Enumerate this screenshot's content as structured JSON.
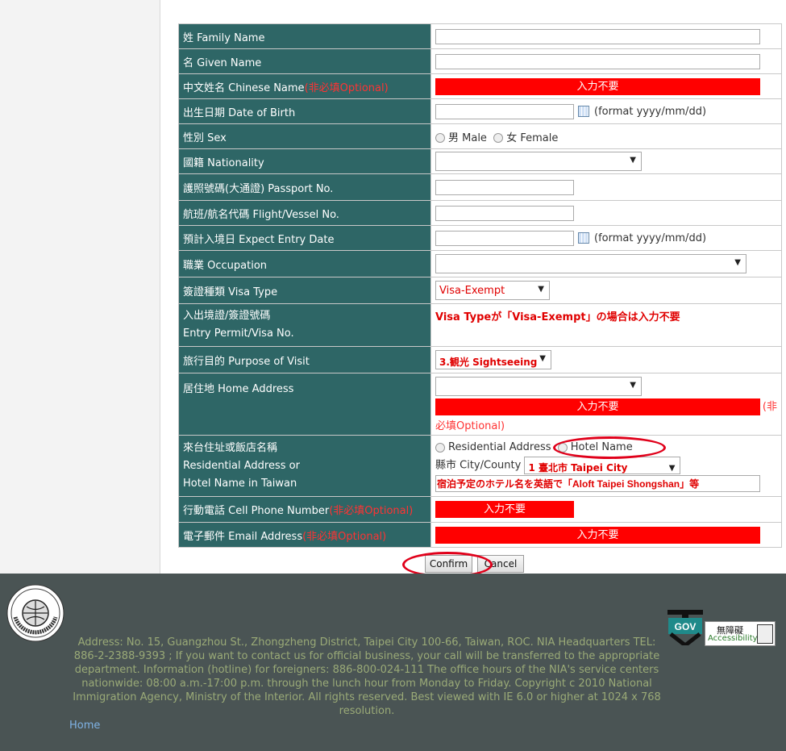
{
  "form": {
    "family_name": {
      "label": "姓 Family Name",
      "value": ""
    },
    "given_name": {
      "label": "名 Given Name",
      "value": ""
    },
    "chinese_name": {
      "label": "中文姓名 Chinese Name",
      "optional": "(非必填Optional)",
      "overlay": "入力不要"
    },
    "dob": {
      "label": "出生日期 Date of Birth",
      "value": "",
      "format": "(format yyyy/mm/dd)"
    },
    "sex": {
      "label": "性別 Sex",
      "male": "男 Male",
      "female": "女 Female"
    },
    "nationality": {
      "label": "國籍 Nationality",
      "value": ""
    },
    "passport": {
      "label": "護照號碼(大通證) Passport No.",
      "value": ""
    },
    "flight": {
      "label": "航班/航名代碼 Flight/Vessel No.",
      "value": ""
    },
    "entry_date": {
      "label": "預計入境日 Expect Entry Date",
      "value": "",
      "format": "(format yyyy/mm/dd)"
    },
    "occupation": {
      "label": "職業 Occupation",
      "value": ""
    },
    "visa_type": {
      "label": "簽證種類 Visa Type",
      "value": "Visa-Exempt"
    },
    "entry_permit": {
      "label_1": "入出境證/簽證號碼",
      "label_2": "Entry Permit/Visa No.",
      "note": "Visa Typeが「Visa-Exempt」の場合は入力不要"
    },
    "purpose": {
      "label": "旅行目的 Purpose of Visit",
      "value": "3.観光 Sightseeing"
    },
    "home_address": {
      "label": "居住地 Home Address",
      "value": "",
      "overlay": "入力不要",
      "optional_1": "(非",
      "optional_2": "必填Optional)"
    },
    "taiwan_address": {
      "label_1": "來台住址或飯店名稱",
      "label_2": "Residential Address or",
      "label_3": "Hotel Name in Taiwan",
      "residential": "Residential Address",
      "hotel": "Hotel Name",
      "city_label": "縣市 City/County",
      "city_value": "1 臺北市 Taipei City",
      "hotel_note": "宿泊予定のホテル名を英語で「Aloft Taipei Shongshan」等"
    },
    "cell_phone": {
      "label": "行動電話 Cell Phone Number",
      "optional": "(非必填Optional)",
      "overlay": "入力不要"
    },
    "email": {
      "label": "電子郵件 Email Address",
      "optional": "(非必填Optional)",
      "overlay": "入力不要"
    }
  },
  "buttons": {
    "confirm": "Confirm",
    "cancel": "Cancel"
  },
  "footer": {
    "address": "Address: No. 15, Guangzhou St., Zhongzheng District, Taipei City 100-66, Taiwan, ROC. NIA Headquarters TEL: 886-2-2388-9393 ; If you want to contact us for official business, your call will be transferred to the appropriate department. Information (hotline) for foreigners: 886-800-024-111 The office hours of the NIA's service centers nationwide: 08:00 a.m.-17:00 p.m. through the lunch hour from Monday to Friday. Copyright c 2010 National Immigration Agency, Ministry of the Interior. All rights reserved. Best viewed with IE 6.0 or higher at 1024 x 768 resolution.",
    "home": "Home",
    "logo_text": "National Immigration Agency",
    "gov": "GOV",
    "a11y_1": "無障礙",
    "a11y_2": "Accessibility"
  },
  "colors": {
    "label_bg": "#2e6666",
    "required_red": "#ff0000",
    "footer_bg": "#4a5454",
    "annotation_ring": "#e0001a"
  }
}
